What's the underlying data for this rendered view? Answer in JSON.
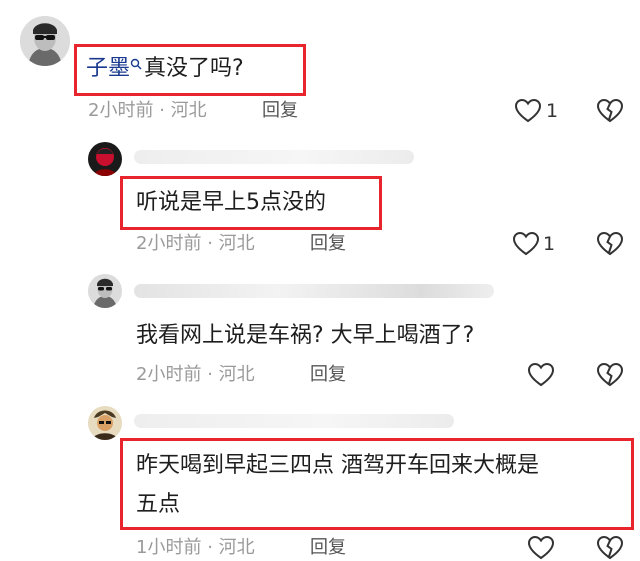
{
  "comments": [
    {
      "username": "子墨",
      "text": "真没了吗?",
      "time": "2小时前",
      "location": "河北",
      "separator": "·",
      "reply_label": "回复",
      "like_count": "1"
    },
    {
      "text": "听说是早上5点没的",
      "time": "2小时前",
      "location": "河北",
      "separator": "·",
      "reply_label": "回复",
      "like_count": "1"
    },
    {
      "text": "我看网上说是车祸? 大早上喝酒了?",
      "time": "2小时前",
      "location": "河北",
      "separator": "·",
      "reply_label": "回复",
      "like_count": ""
    },
    {
      "text_line1": "昨天喝到早起三四点 酒驾开车回来大概是",
      "text_line2": "五点",
      "time": "1小时前",
      "location": "河北",
      "separator": "·",
      "reply_label": "回复",
      "like_count": ""
    }
  ],
  "icons": {
    "like": "heart-outline-icon",
    "dislike": "broken-heart-icon",
    "search": "search-icon"
  },
  "colors": {
    "highlight_border": "#e8242c",
    "username": "#1a3a8f",
    "meta_text": "#9a9a9a"
  }
}
